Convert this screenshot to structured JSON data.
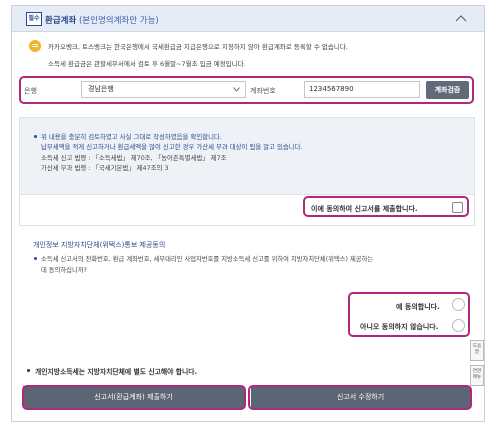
{
  "section": {
    "badge": "필수",
    "title_bold": "환급계좌",
    "title_suffix": "(본인명의계좌만 가능)"
  },
  "info": {
    "line1": "카카오뱅크, 토스뱅크는 한국은행에서 국세환급금 지급은행으로 지정하지 않아 환급계좌로 등록할 수 없습니다.",
    "line2": "소득세 환급금은 관할세무서에서 검토 후 6월말~7월초 입금 예정입니다."
  },
  "bank": {
    "label": "은행",
    "selected": "경남은행",
    "account_label": "계좌번호",
    "account_value": "1234567890",
    "verify_button": "계좌검증"
  },
  "consent": {
    "line1": "위 내용을 충분히 검토하였고 사실 그대로 작성하였음을 확인합니다.",
    "line2": "납부세액을 적게 신고하거나 환급세액을 많이 신고한 경우 가산세 부과 대상이 됨을 알고 있습니다.",
    "line3": "소득세 신고 법령 : 「소득세법」 제70조, 「농어촌특별세법」 제7조",
    "line4": "가산세 부과 법령 : 「국세기본법」 제47조의 3",
    "agree_label": "이에 동의하여 신고서를 제출합니다."
  },
  "privacy": {
    "title": "개인정보 지방자치단체(위택스)통보 제공동의",
    "line1": "소득세 신고서의 전화번호, 환급 계좌번호, 세무대리인 사업자번호를 지방소득세 신고를 위하여 지방자치단체(위택스) 제공하는",
    "line2": "데 동의하십니까?",
    "yes_label": "예 동의합니다.",
    "no_label": "아니오 동의하지 않습니다."
  },
  "side": {
    "help": "도움말",
    "menu": "연관메뉴"
  },
  "footer": {
    "local_tax_notice": "개인지방소득세는 지방자치단체에 별도 신고해야 합니다.",
    "submit_button": "신고서(환급계좌) 제출하기",
    "edit_button": "신고서 수정하기"
  },
  "colors": {
    "highlight": "#b0287d",
    "brand_blue": "#2b4a8a",
    "button_gray": "#5c6573"
  }
}
